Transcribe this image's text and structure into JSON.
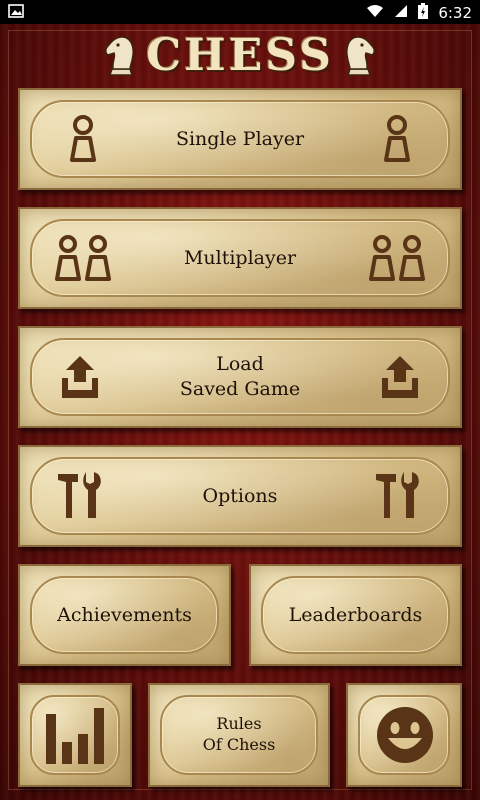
{
  "status_bar": {
    "time": "6:32"
  },
  "title": "CHESS",
  "menu": {
    "single_player": "Single Player",
    "multiplayer": "Multiplayer",
    "load_saved_game": "Load\nSaved Game",
    "options": "Options",
    "achievements": "Achievements",
    "leaderboards": "Leaderboards",
    "rules_of_chess": "Rules\nOf Chess"
  },
  "icons": {
    "single_player": "person-icon",
    "multiplayer": "two-people-icon",
    "load": "upload-tray-icon",
    "options": "hammer-wrench-icon",
    "stats": "bar-chart-icon",
    "smiley": "smiley-icon",
    "knight": "knight-icon"
  },
  "colors": {
    "background": "#6e100c",
    "parchment": "#dcc592",
    "icon_brown": "#5a3416",
    "label": "#1e1208"
  }
}
